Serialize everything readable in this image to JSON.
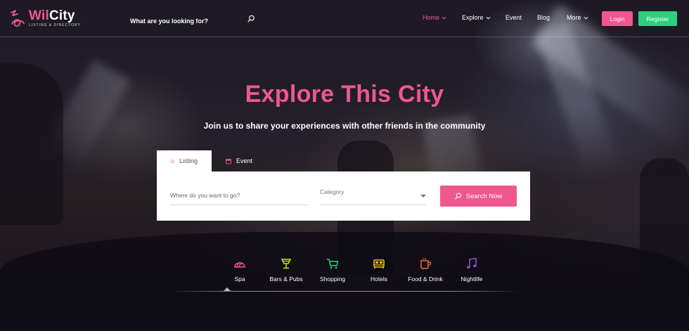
{
  "brand": {
    "name_part1": "Wil",
    "name_part2": "City",
    "tagline": "LISTING & DIRECTORY",
    "accent": "#f0578f",
    "green": "#2fcf7c"
  },
  "header": {
    "search_placeholder": "What are you looking for?",
    "nav": [
      {
        "label": "Home",
        "active": true,
        "dropdown": true
      },
      {
        "label": "Explore",
        "active": false,
        "dropdown": true
      },
      {
        "label": "Event",
        "active": false,
        "dropdown": false
      },
      {
        "label": "Blog",
        "active": false,
        "dropdown": false
      },
      {
        "label": "More",
        "active": false,
        "dropdown": true
      }
    ],
    "login_label": "Login",
    "register_label": "Register"
  },
  "hero": {
    "title": "Explore This City",
    "subtitle": "Join us to share your experiences with other friends in the community"
  },
  "search": {
    "tabs": [
      {
        "label": "Listing",
        "icon": "list-icon",
        "active": true
      },
      {
        "label": "Event",
        "icon": "calendar-icon",
        "active": false
      }
    ],
    "where_placeholder": "Where do you want to go?",
    "category_placeholder": "Category",
    "button_label": "Search Now"
  },
  "categories": [
    {
      "label": "Spa",
      "icon": "spa-icon",
      "color": "#f0578f"
    },
    {
      "label": "Bars & Pubs",
      "icon": "cocktail-icon",
      "color": "#c4e61e"
    },
    {
      "label": "Shopping",
      "icon": "cart-icon",
      "color": "#2fcf7c"
    },
    {
      "label": "Hotels",
      "icon": "bed-icon",
      "color": "#f5c518"
    },
    {
      "label": "Food & Drink",
      "icon": "coffee-icon",
      "color": "#f26a2e"
    },
    {
      "label": "Nightlife",
      "icon": "music-icon",
      "color": "#8a4fe0"
    }
  ]
}
